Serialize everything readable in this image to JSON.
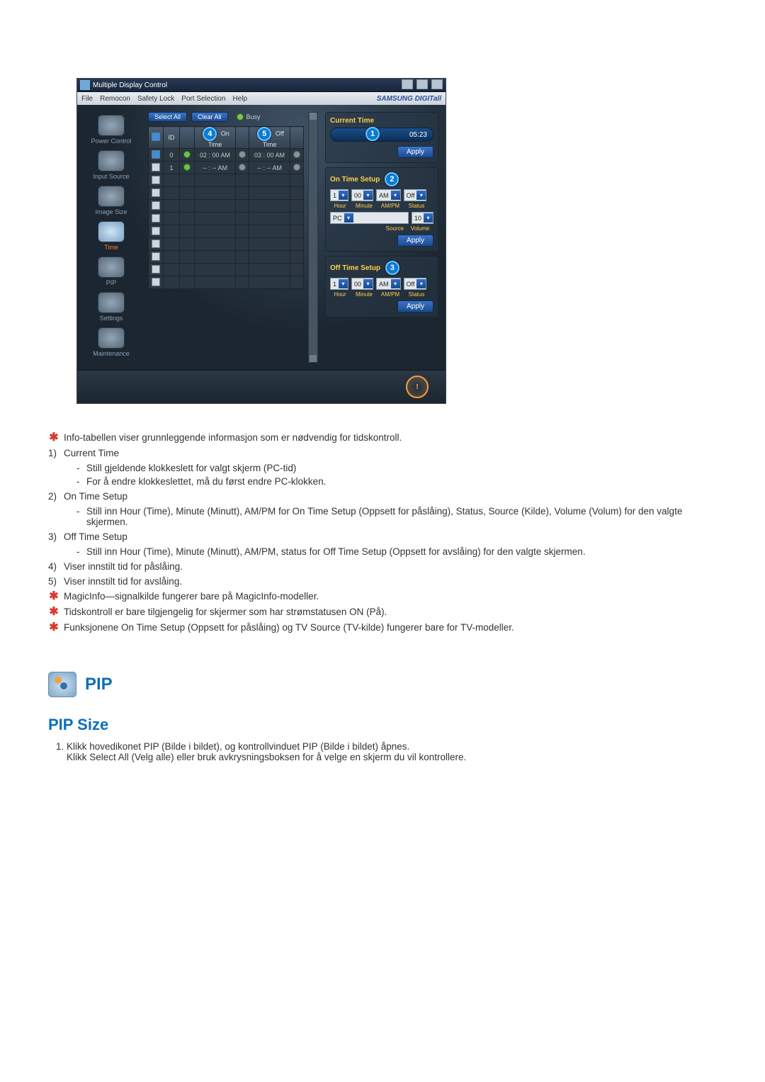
{
  "app": {
    "title": "Multiple Display Control",
    "menu": [
      "File",
      "Remocon",
      "Safety Lock",
      "Port Selection",
      "Help"
    ],
    "brand": "SAMSUNG DIGITall",
    "sidebar": [
      {
        "label": "Power Control"
      },
      {
        "label": "Input Source"
      },
      {
        "label": "Image Size"
      },
      {
        "label": "Time",
        "active": true
      },
      {
        "label": "PIP"
      },
      {
        "label": "Settings"
      },
      {
        "label": "Maintenance"
      }
    ],
    "buttons": {
      "select_all": "Select All",
      "clear_all": "Clear All"
    },
    "busy_label": "Busy",
    "badges": {
      "ontime": "4",
      "offtime": "5",
      "current": "1",
      "onsetup": "2",
      "offsetup": "3"
    },
    "table": {
      "headers": {
        "chk": "",
        "id": "ID",
        "pwr": "",
        "on": "On Time",
        "off": "Off Time"
      },
      "rows": [
        {
          "chk": true,
          "id": "0",
          "on": "02 : 00 AM",
          "off": "03 : 00 AM",
          "led": true
        },
        {
          "chk": false,
          "id": "1",
          "on": "-- : -- AM",
          "off": "-- : -- AM",
          "led": false
        }
      ],
      "blank_rows": 9
    },
    "right": {
      "current_time": {
        "label": "Current Time",
        "value": "05:23",
        "apply": "Apply"
      },
      "on_setup": {
        "label": "On Time Setup",
        "hour": "1",
        "minute": "00",
        "ampm": "AM",
        "status": "Off",
        "labels": {
          "hour": "Hour",
          "minute": "Minute",
          "ampm": "AM/PM",
          "status": "Status"
        },
        "source": "PC",
        "volume": "10",
        "labels2": {
          "source": "Source",
          "volume": "Volume"
        },
        "apply": "Apply"
      },
      "off_setup": {
        "label": "Off Time Setup",
        "hour": "1",
        "minute": "00",
        "ampm": "AM",
        "status": "Off",
        "labels": {
          "hour": "Hour",
          "minute": "Minute",
          "ampm": "AM/PM",
          "status": "Status"
        },
        "apply": "Apply"
      }
    }
  },
  "doc": {
    "intro_star": "Info-tabellen viser grunnleggende informasjon som er nødvendig for tidskontroll.",
    "items": [
      {
        "num": "1)",
        "title": "Current Time",
        "subs": [
          "Still gjeldende klokkeslett for valgt skjerm (PC-tid)",
          "For å endre klokkeslettet, må du først endre PC-klokken."
        ]
      },
      {
        "num": "2)",
        "title": "On Time Setup",
        "subs": [
          "Still inn Hour (Time), Minute (Minutt), AM/PM for On Time Setup (Oppsett for påslåing), Status, Source (Kilde), Volume (Volum) for den valgte skjermen."
        ]
      },
      {
        "num": "3)",
        "title": "Off Time Setup",
        "subs": [
          "Still inn Hour (Time), Minute (Minutt), AM/PM, status for Off Time Setup (Oppsett for avslåing) for den valgte skjermen."
        ]
      },
      {
        "num": "4)",
        "title": "Viser innstilt tid for påslåing."
      },
      {
        "num": "5)",
        "title": "Viser innstilt tid for avslåing."
      }
    ],
    "stars": [
      "MagicInfo—signalkilde fungerer bare på MagicInfo-modeller.",
      "Tidskontroll er bare tilgjengelig for skjermer som har strømstatusen ON (På).",
      "Funksjonene On Time Setup (Oppsett for påslåing) og TV Source (TV-kilde) fungerer bare for TV-modeller."
    ],
    "pip_heading": "PIP",
    "pip_sub": "PIP Size",
    "pip_steps": [
      "Klikk hovedikonet PIP (Bilde i bildet), og kontrollvinduet PIP (Bilde i bildet) åpnes.\nKlikk Select All (Velg alle) eller bruk avkrysningsboksen for å velge en skjerm du vil kontrollere."
    ]
  }
}
